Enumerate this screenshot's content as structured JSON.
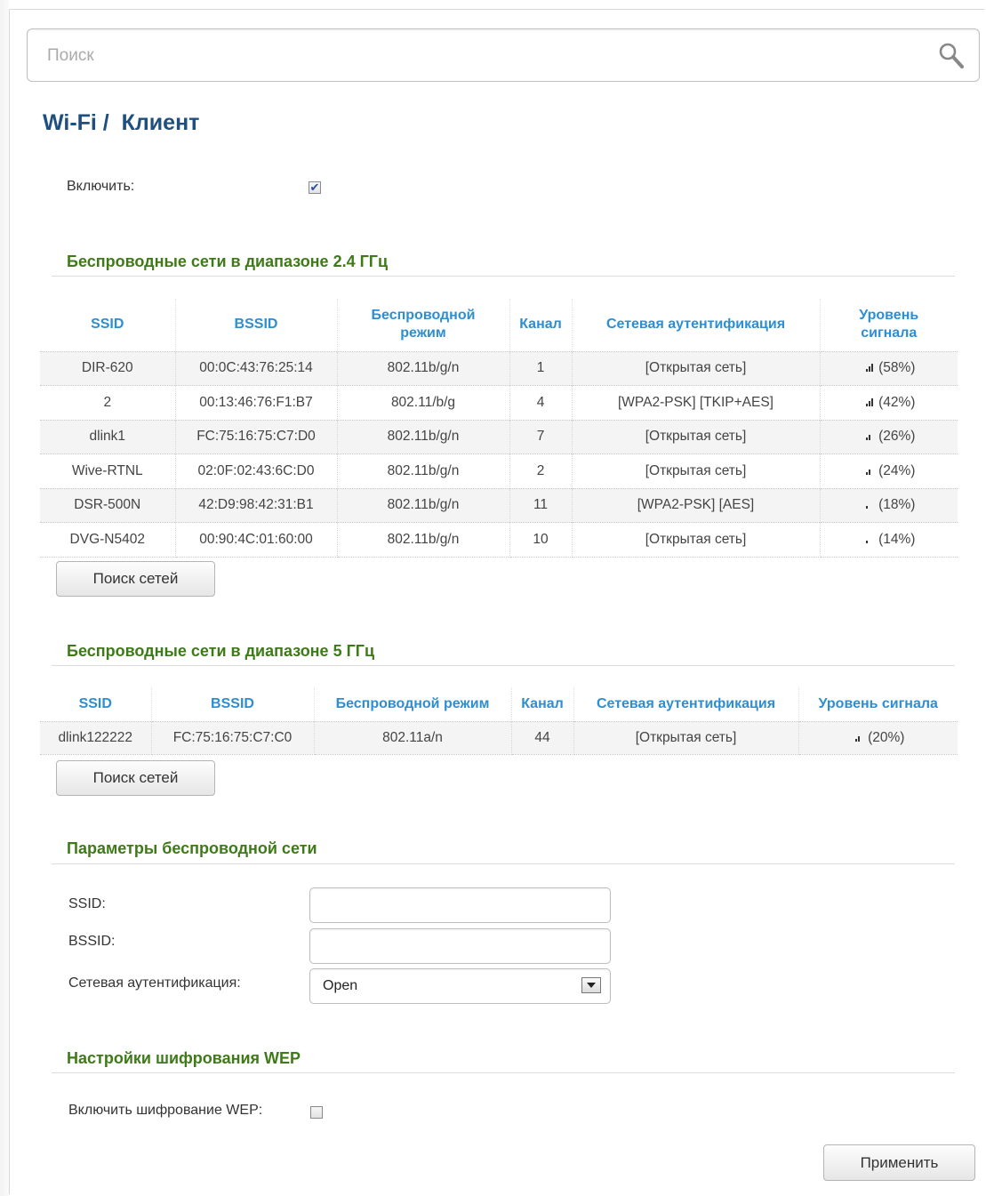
{
  "search": {
    "placeholder": "Поиск"
  },
  "breadcrumb": {
    "section": "Wi-Fi /",
    "page": "Клиент"
  },
  "enable": {
    "label": "Включить:",
    "checked": true
  },
  "band24": {
    "title": "Беспроводные сети в диапазоне 2.4 ГГц",
    "headers": [
      "SSID",
      "BSSID",
      "Беспроводной режим",
      "Канал",
      "Сетевая аутентификация",
      "Уровень сигнала"
    ],
    "rows": [
      [
        "DIR-620",
        "00:0C:43:76:25:14",
        "802.11b/g/n",
        "1",
        "[Открытая сеть]",
        "(58%)"
      ],
      [
        "2",
        "00:13:46:76:F1:B7",
        "802.11/b/g",
        "4",
        "[WPA2-PSK] [TKIP+AES]",
        "(42%)"
      ],
      [
        "dlink1",
        "FC:75:16:75:C7:D0",
        "802.11b/g/n",
        "7",
        "[Открытая сеть]",
        "(26%)"
      ],
      [
        "Wive-RTNL",
        "02:0F:02:43:6C:D0",
        "802.11b/g/n",
        "2",
        "[Открытая сеть]",
        "(24%)"
      ],
      [
        "DSR-500N",
        "42:D9:98:42:31:B1",
        "802.11b/g/n",
        "11",
        "[WPA2-PSK] [AES]",
        "(18%)"
      ],
      [
        "DVG-N5402",
        "00:90:4C:01:60:00",
        "802.11b/g/n",
        "10",
        "[Открытая сеть]",
        "(14%)"
      ]
    ],
    "scan_button": "Поиск сетей"
  },
  "band5": {
    "title": "Беспроводные сети в диапазоне 5 ГГц",
    "headers": [
      "SSID",
      "BSSID",
      "Беспроводной режим",
      "Канал",
      "Сетевая аутентификация",
      "Уровень сигнала"
    ],
    "rows": [
      [
        "dlink122222",
        "FC:75:16:75:C7:C0",
        "802.11a/n",
        "44",
        "[Открытая сеть]",
        "(20%)"
      ]
    ],
    "scan_button": "Поиск сетей"
  },
  "params": {
    "title": "Параметры беспроводной сети",
    "ssid_label": "SSID:",
    "ssid_value": "",
    "bssid_label": "BSSID:",
    "bssid_value": "",
    "auth_label": "Сетевая аутентификация:",
    "auth_value": "Open"
  },
  "wep": {
    "title": "Настройки шифрования WEP",
    "enable_label": "Включить шифрование WEP:",
    "enabled": false
  },
  "apply_button": "Применить",
  "colors": {
    "title": "#1f4f7e",
    "section": "#3e7a18",
    "header": "#2d8ed1"
  }
}
